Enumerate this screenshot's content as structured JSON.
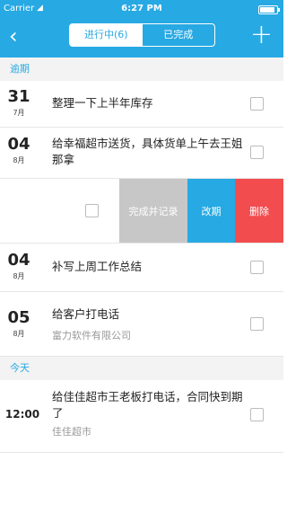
{
  "statusbar": {
    "carrier": "Carrier",
    "time": "6:27 PM"
  },
  "navbar": {
    "tabs": [
      {
        "label": "进行中(6)",
        "active": true
      },
      {
        "label": "已完成",
        "active": false
      }
    ]
  },
  "sections": {
    "overdue": "逾期",
    "today": "今天"
  },
  "tasks": [
    {
      "day": "31",
      "month": "7月",
      "title": "整理一下上半年库存"
    },
    {
      "day": "04",
      "month": "8月",
      "title": "给幸福超市送货，具体货单上午去王姐那拿"
    },
    {
      "day": "04",
      "month": "8月",
      "title": "补写上周工作总结"
    },
    {
      "day": "05",
      "month": "8月",
      "title": "给客户打电话",
      "subtitle": "富力软件有限公司"
    },
    {
      "time": "12:00",
      "title": "给佳佳超市王老板打电话，合同快到期了",
      "subtitle": "佳佳超市"
    }
  ],
  "swipe_actions": {
    "complete": "完成并记录",
    "reschedule": "改期",
    "delete": "删除"
  },
  "colors": {
    "primary": "#27a9e3",
    "complete_action": "#c7c7c7",
    "reschedule_action": "#27a9e3",
    "delete_action": "#f24c4f"
  }
}
